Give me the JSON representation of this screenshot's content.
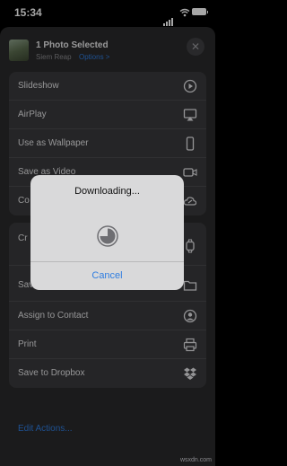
{
  "status_bar": {
    "time": "15:34"
  },
  "header": {
    "title": "1 Photo Selected",
    "location": "Siem Reap",
    "options_label": "Options >",
    "close_symbol": "✕"
  },
  "group1": [
    {
      "label": "Slideshow",
      "icon": "play-circle-icon"
    },
    {
      "label": "AirPlay",
      "icon": "airplay-icon"
    },
    {
      "label": "Use as Wallpaper",
      "icon": "phone-icon"
    },
    {
      "label": "Save as Video",
      "icon": "video-camera-icon"
    },
    {
      "label": "Co",
      "icon": "cloud-link-icon"
    }
  ],
  "group2": [
    {
      "label": "Cr",
      "icon": "watch-icon"
    },
    {
      "label": "Save to Files",
      "icon": "folder-icon"
    },
    {
      "label": "Assign to Contact",
      "icon": "contact-icon"
    },
    {
      "label": "Print",
      "icon": "printer-icon"
    },
    {
      "label": "Save to Dropbox",
      "icon": "dropbox-icon"
    }
  ],
  "edit_actions": "Edit Actions...",
  "alert": {
    "title": "Downloading...",
    "progress": 0.75,
    "cancel_label": "Cancel"
  },
  "watermark": "wsxdn.com",
  "colors": {
    "accent": "#2f7de0",
    "sheet": "#2a2a2b",
    "row": "#3a3a3c",
    "alert": "#d9d9da"
  }
}
